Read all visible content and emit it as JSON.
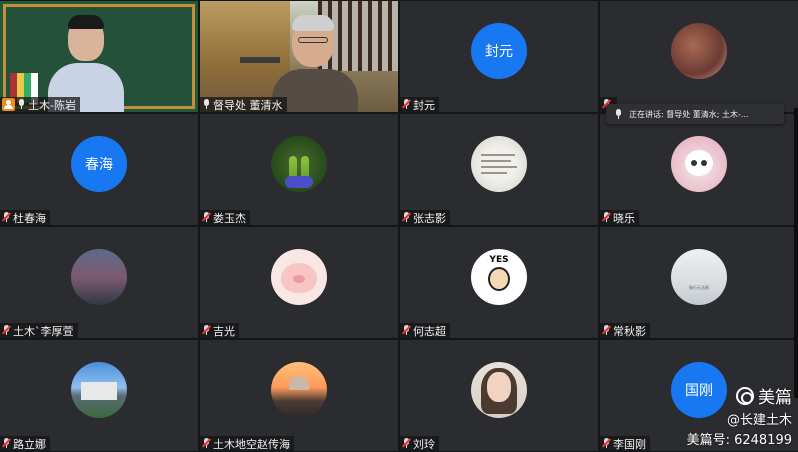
{
  "tiles": [
    {
      "name": "土木-陈岩",
      "type": "video1",
      "host": true,
      "muted": false
    },
    {
      "name": "督导处 董清水",
      "type": "video2",
      "host": false,
      "muted": false,
      "active": true
    },
    {
      "name": "封元",
      "type": "text",
      "avatar_text": "封元",
      "muted": true
    },
    {
      "name": "",
      "type": "img",
      "img": "cats",
      "muted": true
    },
    {
      "name": "杜春海",
      "type": "text",
      "avatar_text": "春海",
      "muted": true
    },
    {
      "name": "娄玉杰",
      "type": "img",
      "img": "lupine",
      "muted": true
    },
    {
      "name": "张志影",
      "type": "img",
      "img": "paper",
      "muted": true
    },
    {
      "name": "晓乐",
      "type": "img",
      "img": "cat",
      "muted": true
    },
    {
      "name": "土木`李厚萱",
      "type": "img",
      "img": "city",
      "muted": true
    },
    {
      "name": "吉光",
      "type": "img",
      "img": "pig",
      "muted": true
    },
    {
      "name": "何志超",
      "type": "img",
      "img": "yes",
      "muted": true
    },
    {
      "name": "常秋影",
      "type": "img",
      "img": "mist",
      "muted": true
    },
    {
      "name": "路立娜",
      "type": "img",
      "img": "castle",
      "muted": true
    },
    {
      "name": "土木地空赵传海",
      "type": "img",
      "img": "sunset",
      "muted": true
    },
    {
      "name": "刘玲",
      "type": "img",
      "img": "girl",
      "muted": true
    },
    {
      "name": "李国刚",
      "type": "text",
      "avatar_text": "国刚",
      "muted": true
    }
  ],
  "image_text": {
    "yes": "YES",
    "mist": "脑行无法痕"
  },
  "speaking_indicator": "正在讲话: 督导处 董清水; 土木-...",
  "watermark": {
    "brand": "美篇",
    "account": "@长建土木",
    "id_label": "美篇号: 6248199"
  },
  "colors": {
    "avatar_blue": "#1778f2",
    "active_border": "#3fb34f",
    "host_badge": "#f08a1c",
    "mute_red": "#e33333"
  }
}
